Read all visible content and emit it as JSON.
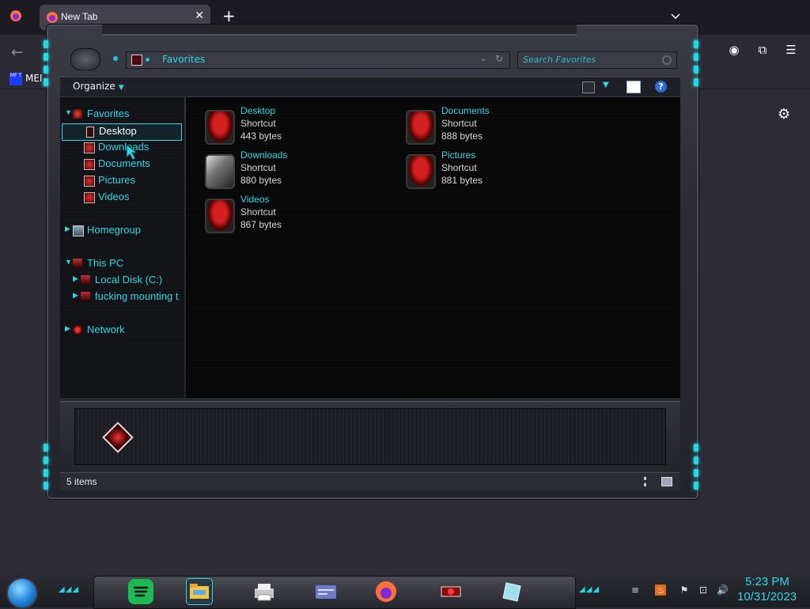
{
  "browser": {
    "tab_title": "New Tab",
    "bookmark_label": "MEI",
    "bookmark_icon_text": "MF T"
  },
  "explorer": {
    "address": "Favorites",
    "search_placeholder": "Search Favorites",
    "toolbar": {
      "organize_label": "Organize"
    },
    "nav_tree": {
      "favorites": "Favorites",
      "favorites_children": [
        "Desktop",
        "Downloads",
        "Documents",
        "Pictures",
        "Videos"
      ],
      "homegroup": "Homegroup",
      "this_pc": "This PC",
      "this_pc_children": [
        "Local Disk (C:)",
        "fucking mounting t"
      ],
      "network": "Network"
    },
    "selected_nav": "Desktop",
    "files": [
      {
        "name": "Desktop",
        "type": "Shortcut",
        "size": "443 bytes"
      },
      {
        "name": "Documents",
        "type": "Shortcut",
        "size": "888 bytes"
      },
      {
        "name": "Downloads",
        "type": "Shortcut",
        "size": "880 bytes"
      },
      {
        "name": "Pictures",
        "type": "Shortcut",
        "size": "881 bytes"
      },
      {
        "name": "Videos",
        "type": "Shortcut",
        "size": "867 bytes"
      }
    ],
    "status": "5 items"
  },
  "taskbar": {
    "time": "5:23 PM",
    "date": "10/31/2023",
    "apps": [
      "spotify-icon",
      "file-explorer-icon",
      "printer-icon",
      "card-icon",
      "firefox-icon",
      "red-app-icon",
      "notes-icon"
    ]
  },
  "colors": {
    "accent": "#2fd6e8",
    "light": "#1fd8e8"
  }
}
